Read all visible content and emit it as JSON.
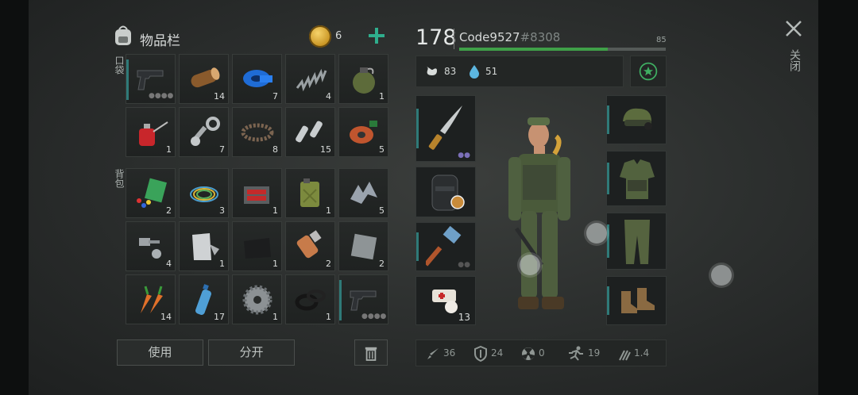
{
  "inventory": {
    "title": "物品栏",
    "coins": "6",
    "pocket_label": "口袋",
    "backpack_label": "背包",
    "use_label": "使用",
    "split_label": "分开",
    "slots": [
      {
        "icon": "pistol-icon",
        "qty": ""
      },
      {
        "icon": "log-icon",
        "qty": "14"
      },
      {
        "icon": "tape-icon",
        "qty": "7"
      },
      {
        "icon": "spring-icon",
        "qty": "4"
      },
      {
        "icon": "grenade-icon",
        "qty": "1"
      },
      {
        "icon": "oil-can-icon",
        "qty": "1"
      },
      {
        "icon": "connecting-rod-icon",
        "qty": "7"
      },
      {
        "icon": "belt-icon",
        "qty": "8"
      },
      {
        "icon": "fuse-icon",
        "qty": "15"
      },
      {
        "icon": "coil-icon",
        "qty": "5"
      },
      {
        "icon": "parts-kit-icon",
        "qty": "2"
      },
      {
        "icon": "wires-icon",
        "qty": "3"
      },
      {
        "icon": "toolbox-icon",
        "qty": "1"
      },
      {
        "icon": "jerrycan-icon",
        "qty": "1"
      },
      {
        "icon": "scrap-metal-icon",
        "qty": "5"
      },
      {
        "icon": "bolts-icon",
        "qty": "4"
      },
      {
        "icon": "cloth-icon",
        "qty": "1"
      },
      {
        "icon": "leather-icon",
        "qty": "1"
      },
      {
        "icon": "motor-icon",
        "qty": "2"
      },
      {
        "icon": "metal-plate-icon",
        "qty": "2"
      },
      {
        "icon": "carrot-icon",
        "qty": "14"
      },
      {
        "icon": "water-bottle-icon",
        "qty": "17"
      },
      {
        "icon": "gear-icon",
        "qty": "1"
      },
      {
        "icon": "rubber-rings-icon",
        "qty": "1"
      },
      {
        "icon": "pistol-icon",
        "qty": ""
      }
    ]
  },
  "player": {
    "level": "178",
    "name": "Code9527",
    "tag": "#8308",
    "xp_max": "85",
    "xp_fraction": 0.72,
    "hunger": "83",
    "thirst": "51",
    "equipment": {
      "machete_qty": "",
      "medkit_qty": "13"
    },
    "stats": {
      "attack": "36",
      "defense": "24",
      "radiation": "0",
      "speed": "19",
      "stealth": "1.4"
    }
  },
  "close_label": "关闭"
}
